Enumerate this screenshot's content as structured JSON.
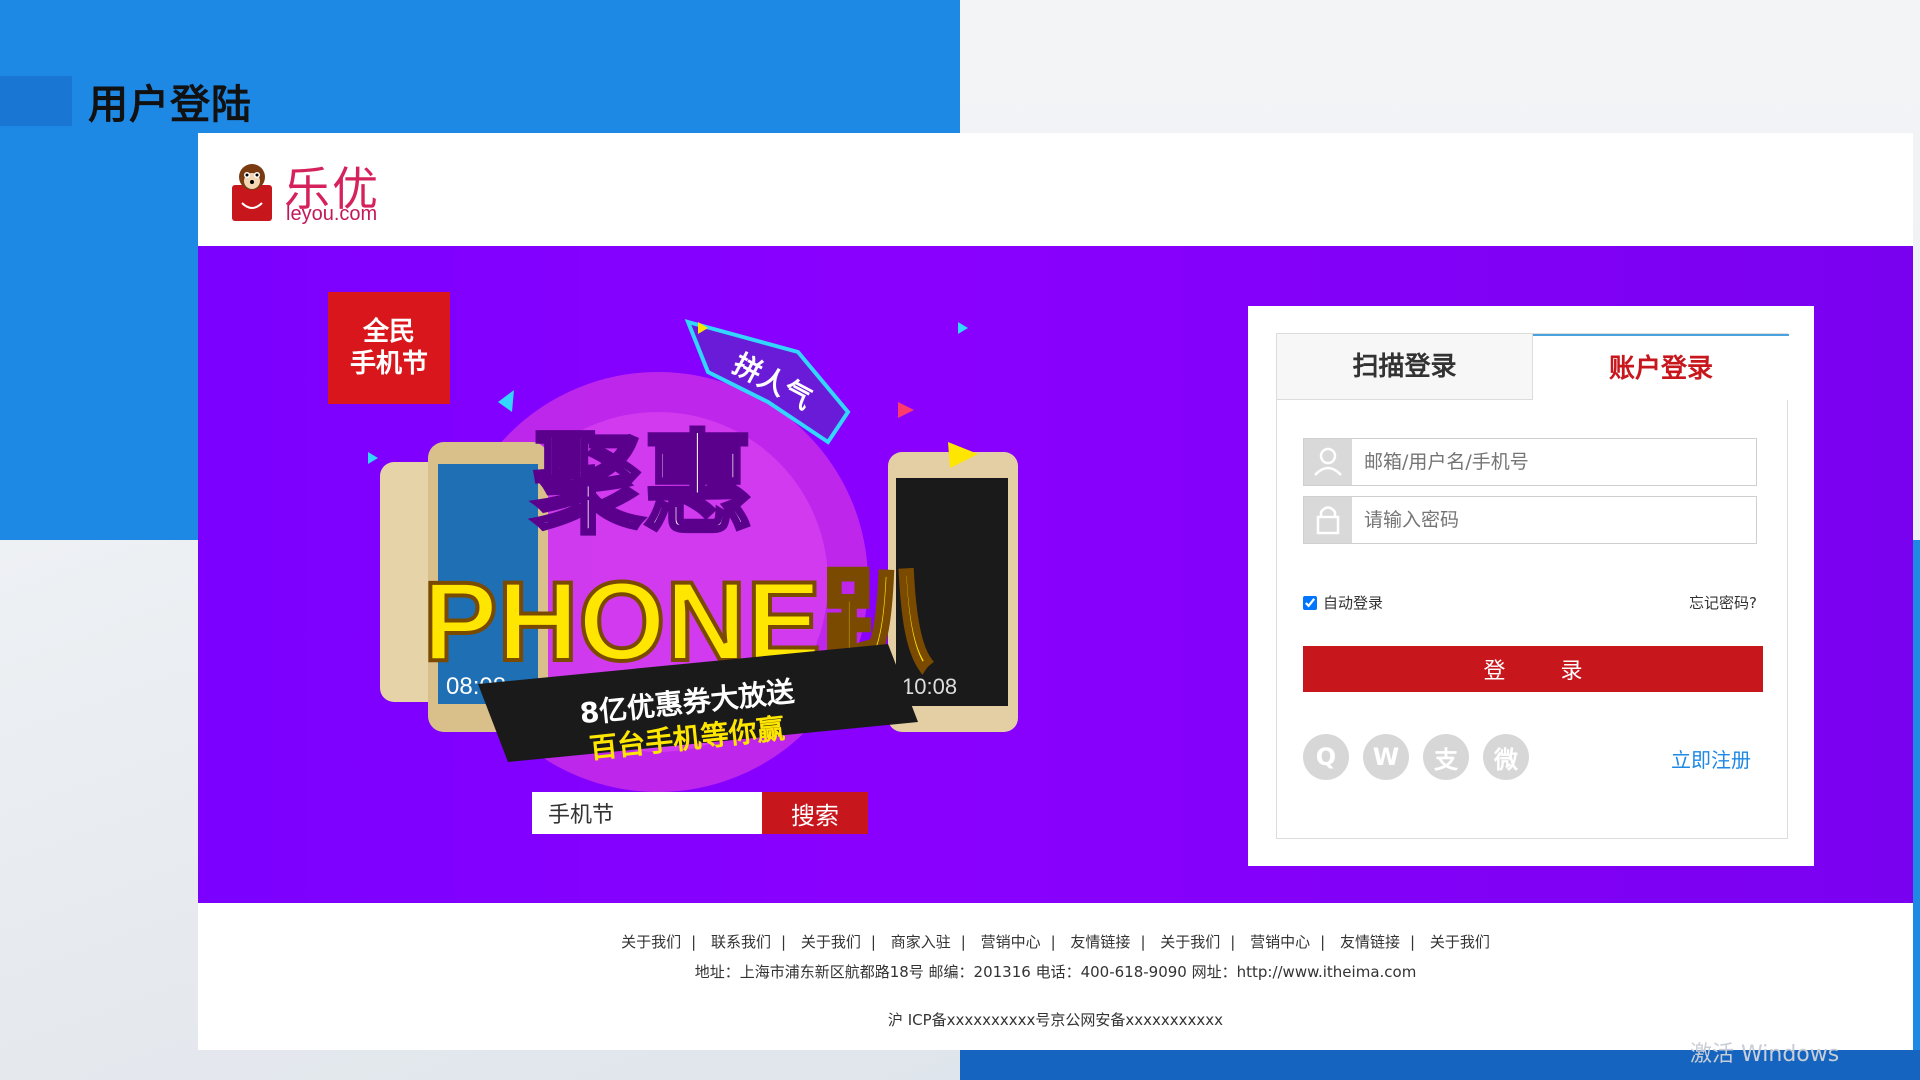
{
  "slide": {
    "title": "用户登陆"
  },
  "header": {
    "logo_cn": "乐优",
    "logo_en": "leyou.com"
  },
  "banner": {
    "festival_badge": "全民手机节",
    "headline": "聚惠",
    "subline": "PHONE趴",
    "ribbon": "拼人气",
    "promo_line1": "8亿优惠券大放送",
    "promo_line2": "百台手机等你赢",
    "phone_time_left": "08:08",
    "phone_time_right": "10:08",
    "search_value": "手机节",
    "search_button": "搜索"
  },
  "login": {
    "tab_scan": "扫描登录",
    "tab_account": "账户登录",
    "username_placeholder": "邮箱/用户名/手机号",
    "password_placeholder": "请输入密码",
    "auto_login": "自动登录",
    "forgot": "忘记密码?",
    "submit": "登 录",
    "register": "立即注册",
    "social": [
      {
        "name": "qq-icon",
        "glyph": "Q"
      },
      {
        "name": "weibo-icon",
        "glyph": "W"
      },
      {
        "name": "alipay-icon",
        "glyph": "支"
      },
      {
        "name": "wechat-icon",
        "glyph": "微"
      }
    ]
  },
  "footer": {
    "links": [
      "关于我们",
      "联系我们",
      "关于我们",
      "商家入驻",
      "营销中心",
      "友情链接",
      "关于我们",
      "营销中心",
      "友情链接",
      "关于我们"
    ],
    "address": "地址：上海市浦东新区航都路18号 邮编：201316 电话：400-618-9090 网址：http://www.itheima.com",
    "icp": "沪 ICP备xxxxxxxxxx号京公网安备xxxxxxxxxxx"
  },
  "watermark": "激活 Windows",
  "colors": {
    "brand_red": "#c8161d",
    "banner_purple": "#8000ff",
    "slide_blue": "#1e88e5",
    "link_blue": "#1e88e5"
  }
}
